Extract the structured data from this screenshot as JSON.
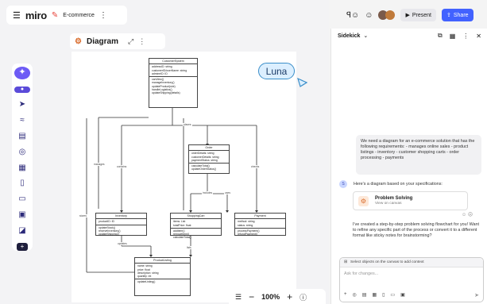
{
  "app": {
    "logo": "miro",
    "board_name": "E-commerce",
    "menu_icon": "hamburger-icon",
    "more_icon": "vertical-dots-icon"
  },
  "toolbar_left": {
    "tools": [
      {
        "name": "ai-sparkle-icon",
        "glyph": "✦"
      },
      {
        "name": "toggle-icon",
        "glyph": "●"
      },
      {
        "name": "select-cursor-icon",
        "glyph": "➤"
      },
      {
        "name": "pen-icon",
        "glyph": "⌇"
      },
      {
        "name": "document-icon",
        "glyph": "▤"
      },
      {
        "name": "shapes-icon",
        "glyph": "◎"
      },
      {
        "name": "table-icon",
        "glyph": "▦"
      },
      {
        "name": "sticky-note-icon",
        "glyph": "▯"
      },
      {
        "name": "card-icon",
        "glyph": "▭"
      },
      {
        "name": "frame-icon",
        "glyph": "▣"
      },
      {
        "name": "comment-icon",
        "glyph": "◪"
      },
      {
        "name": "add-more-icon",
        "glyph": "+"
      }
    ]
  },
  "diagram": {
    "title": "Diagram",
    "expand_icon": "expand-icon",
    "more_icon": "vertical-dots-icon"
  },
  "er": {
    "customer": {
      "title": "CustomerSystem",
      "s1": [
        "addressID: string",
        "customerID/userName: string",
        "admineID: ID"
      ],
      "s2": [
        "canView()",
        "manageInventory()",
        "updateProduct(slot)",
        "handleLogistics()",
        "updateShipping(details)"
      ]
    },
    "order": {
      "title": "Order",
      "s1": [
        "orderDetails: string",
        "customerDetails: string",
        "paymentStatus: string"
      ],
      "s2": [
        "calculateTotal()",
        "updateOrderStatus()"
      ]
    },
    "inventory": {
      "title": "Inventory",
      "s1": [
        "productID: ID"
      ],
      "s2": [
        "updateStock()",
        "reserveInventory()",
        "updateShipping()"
      ]
    },
    "shopping": {
      "title": "ShoppingCart",
      "s1": [
        "items: List",
        "totalPrice: float"
      ],
      "s2": [
        "addItem()",
        "removeItem()",
        "calculateTotal()"
      ]
    },
    "payment": {
      "title": "Payment",
      "s1": [
        "method: string",
        "status: string"
      ],
      "s2": [
        "processPayment()",
        "refundPayment()"
      ]
    },
    "product": {
      "title": "ProductListing",
      "s1": [
        "name: string",
        "price: float",
        "description: string",
        "quantity: int"
      ],
      "s2": [
        "updateListing()"
      ]
    },
    "relations": {
      "places": "places",
      "contains": "contains",
      "checks": "checks",
      "includes": "includes",
      "uses": "uses",
      "updates": "updates",
      "lists": "lists",
      "stores": "stores",
      "manages": "manages"
    }
  },
  "luna": {
    "label": "Luna",
    "color": "#3a8ec9"
  },
  "zoom": {
    "level": "100%",
    "list_icon": "list-icon",
    "minus_icon": "minus-icon",
    "plus_icon": "plus-icon",
    "help_icon": "help-icon"
  },
  "top_right": {
    "present_label": "Present",
    "share_label": "Share",
    "reactions_icon": "reactions-icon",
    "emoji_icon": "emoji-icon"
  },
  "sidekick": {
    "title": "Sidekick",
    "user_message": "We need a diagram for an e-commerce solution that has the following requirements: - manages online sales - product listings - inventory - customer shopping carts - order processing - payments",
    "assistant_intro": "Here's a diagram based on your specifications:",
    "card_title": "Problem Solving",
    "card_subtitle": "View on canvas",
    "assistant_message": "I've created a step-by-step problem solving flowchart for you! Want to refine any specific part of the process or convert it to a different format like sticky notes for brainstorming?",
    "select_hint": "Select objects on the canvas to add context",
    "input_placeholder": "Ask for changes..."
  },
  "colors": {
    "accent": "#4262ff",
    "ai_purple": "#6d5bf5",
    "miro_red": "#e8453c"
  }
}
